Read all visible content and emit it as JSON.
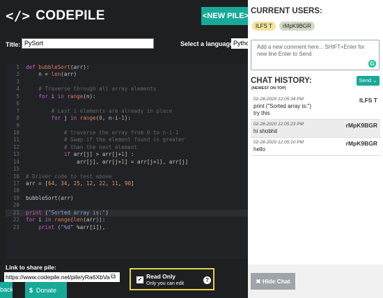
{
  "header": {
    "logo_mark": "</>",
    "logo_text": "CODEPILE",
    "new_pile": "<NEW PILE>"
  },
  "form": {
    "title_label": "Title:",
    "title_value": "PySort",
    "language_label": "Select a language:",
    "language_value": "Pytho"
  },
  "editor": {
    "lines": [
      {
        "n": "1",
        "t": [
          [
            "kw",
            "def "
          ],
          [
            "fn",
            "bubbleSort"
          ],
          [
            "op",
            "(arr):"
          ]
        ]
      },
      {
        "n": "2",
        "t": [
          [
            "op",
            "    n = "
          ],
          [
            "fn",
            "len"
          ],
          [
            "op",
            "(arr)"
          ]
        ]
      },
      {
        "n": "3",
        "t": []
      },
      {
        "n": "4",
        "t": [
          [
            "cm",
            "    # Traverse through all array elements"
          ]
        ]
      },
      {
        "n": "5",
        "t": [
          [
            "kw",
            "    for "
          ],
          [
            "op",
            "i "
          ],
          [
            "kw",
            "in "
          ],
          [
            "fn",
            "range"
          ],
          [
            "op",
            "(n):"
          ]
        ]
      },
      {
        "n": "6",
        "t": []
      },
      {
        "n": "7",
        "t": [
          [
            "cm",
            "        # Last i elements are already in place"
          ]
        ]
      },
      {
        "n": "8",
        "t": [
          [
            "kw",
            "        for "
          ],
          [
            "op",
            "j "
          ],
          [
            "kw",
            "in "
          ],
          [
            "fn",
            "range"
          ],
          [
            "op",
            "("
          ],
          [
            "num",
            "0"
          ],
          [
            "op",
            ", n-i-"
          ],
          [
            "num",
            "1"
          ],
          [
            "op",
            "):"
          ]
        ]
      },
      {
        "n": "9",
        "t": []
      },
      {
        "n": "10",
        "t": [
          [
            "cm",
            "            # traverse the array from 0 to n-i-1"
          ]
        ]
      },
      {
        "n": "11",
        "t": [
          [
            "cm",
            "            # Swap if the element found is greater"
          ]
        ]
      },
      {
        "n": "12",
        "t": [
          [
            "cm",
            "            # than the next element"
          ]
        ]
      },
      {
        "n": "13",
        "t": [
          [
            "kw",
            "            if "
          ],
          [
            "op",
            "arr[j] > arr[j+"
          ],
          [
            "num",
            "1"
          ],
          [
            "op",
            "] :"
          ]
        ]
      },
      {
        "n": "14",
        "t": [
          [
            "op",
            "                arr[j], arr[j+"
          ],
          [
            "num",
            "1"
          ],
          [
            "op",
            "] = arr[j+"
          ],
          [
            "num",
            "1"
          ],
          [
            "op",
            "], arr[j]"
          ]
        ]
      },
      {
        "n": "15",
        "t": []
      },
      {
        "n": "16",
        "t": [
          [
            "cm",
            "# Driver code to test above"
          ]
        ]
      },
      {
        "n": "17",
        "t": [
          [
            "op",
            "arr = ["
          ],
          [
            "num",
            "64"
          ],
          [
            "op",
            ", "
          ],
          [
            "num",
            "34"
          ],
          [
            "op",
            ", "
          ],
          [
            "num",
            "25"
          ],
          [
            "op",
            ", "
          ],
          [
            "num",
            "12"
          ],
          [
            "op",
            ", "
          ],
          [
            "num",
            "22"
          ],
          [
            "op",
            ", "
          ],
          [
            "num",
            "11"
          ],
          [
            "op",
            ", "
          ],
          [
            "num",
            "90"
          ],
          [
            "op",
            "]"
          ]
        ]
      },
      {
        "n": "18",
        "t": []
      },
      {
        "n": "19",
        "t": [
          [
            "op",
            "bubbleSort(arr)"
          ]
        ]
      },
      {
        "n": "20",
        "t": []
      },
      {
        "n": "21",
        "t": [
          [
            "kw",
            "print "
          ],
          [
            "op",
            "("
          ],
          [
            "str",
            "\"Sorted array is:\""
          ],
          [
            "op",
            ")"
          ]
        ],
        "hl": true
      },
      {
        "n": "22",
        "t": [
          [
            "kw",
            "for "
          ],
          [
            "op",
            "i "
          ],
          [
            "kw",
            "in "
          ],
          [
            "fn",
            "range"
          ],
          [
            "op",
            "("
          ],
          [
            "fn",
            "len"
          ],
          [
            "op",
            "(arr)):"
          ]
        ]
      },
      {
        "n": "23",
        "t": [
          [
            "kw",
            "    print "
          ],
          [
            "op",
            "("
          ],
          [
            "str",
            "\"%d\""
          ],
          [
            "op",
            " %arr[i]),"
          ]
        ]
      }
    ]
  },
  "share": {
    "label": "Link to share pile:",
    "url": "https://www.codepile.net/pile/yRa6XbVa"
  },
  "footer": {
    "back": "back",
    "donate_icon": "$",
    "donate": "Donate"
  },
  "readonly": {
    "title": "Read Only",
    "subtitle": "Only you can edit",
    "help": "?"
  },
  "sidebar": {
    "current_users_title": "CURRENT USERS:",
    "users": [
      {
        "name": "ILFS T",
        "color": "#f1e49a"
      },
      {
        "name": "rMpK9BGR",
        "color": "#cfd8c4"
      }
    ],
    "comment_placeholder": "Add a new comment here... SHIFT+Enter for new line Enter to Send",
    "chat_history_title": "CHAT HISTORY:",
    "chat_history_sub": "(NEWEST ON TOP)",
    "send": "Send",
    "messages": [
      {
        "ts": "02-28-2020 12:05:34 PM",
        "user": "ILFS T",
        "lines": [
          "print (\"Sorted array is:\")",
          "try this"
        ]
      },
      {
        "ts": "02-28-2020 12:05:23 PM",
        "user": "rMpK9BGR",
        "lines": [
          "hi shobhit"
        ]
      },
      {
        "ts": "02-28-2020 12:05:10 PM",
        "user": "rMpK9BGR",
        "lines": [
          "hello"
        ]
      }
    ],
    "hide_chat": "Hide Chat"
  },
  "colors": {
    "accent": "#18a999",
    "highlight_border": "#e4d24a"
  }
}
